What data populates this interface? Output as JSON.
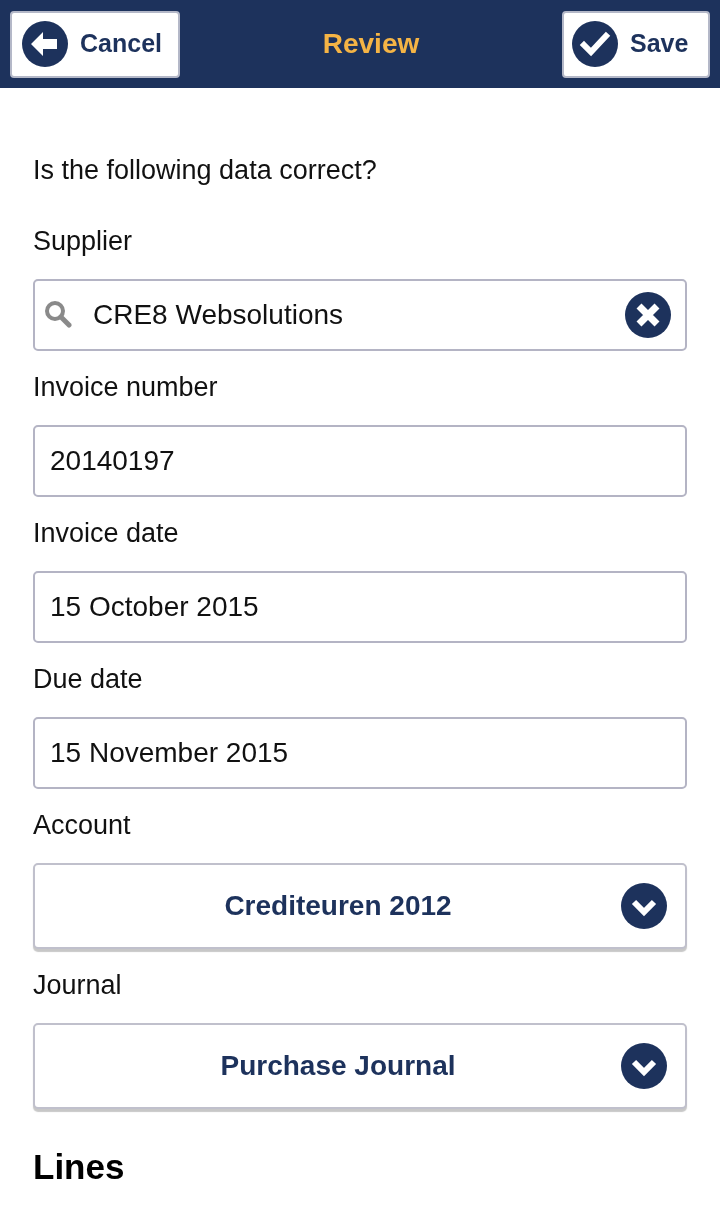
{
  "header": {
    "cancel_button": "Cancel",
    "title": "Review",
    "save_button": "Save"
  },
  "form": {
    "question": "Is the following data correct?",
    "fields": [
      {
        "kind": "search",
        "label": "Supplier",
        "value": "CRE8 Websolutions"
      },
      {
        "kind": "text",
        "label": "Invoice number",
        "value": "20140197"
      },
      {
        "kind": "text",
        "label": "Invoice date",
        "value": "15 October 2015"
      },
      {
        "kind": "text",
        "label": "Due date",
        "value": "15 November 2015"
      },
      {
        "kind": "select",
        "label": "Account",
        "value": "Crediteuren 2012"
      },
      {
        "kind": "select",
        "label": "Journal",
        "value": "Purchase Journal"
      }
    ]
  },
  "lines": {
    "heading": "Lines"
  }
}
